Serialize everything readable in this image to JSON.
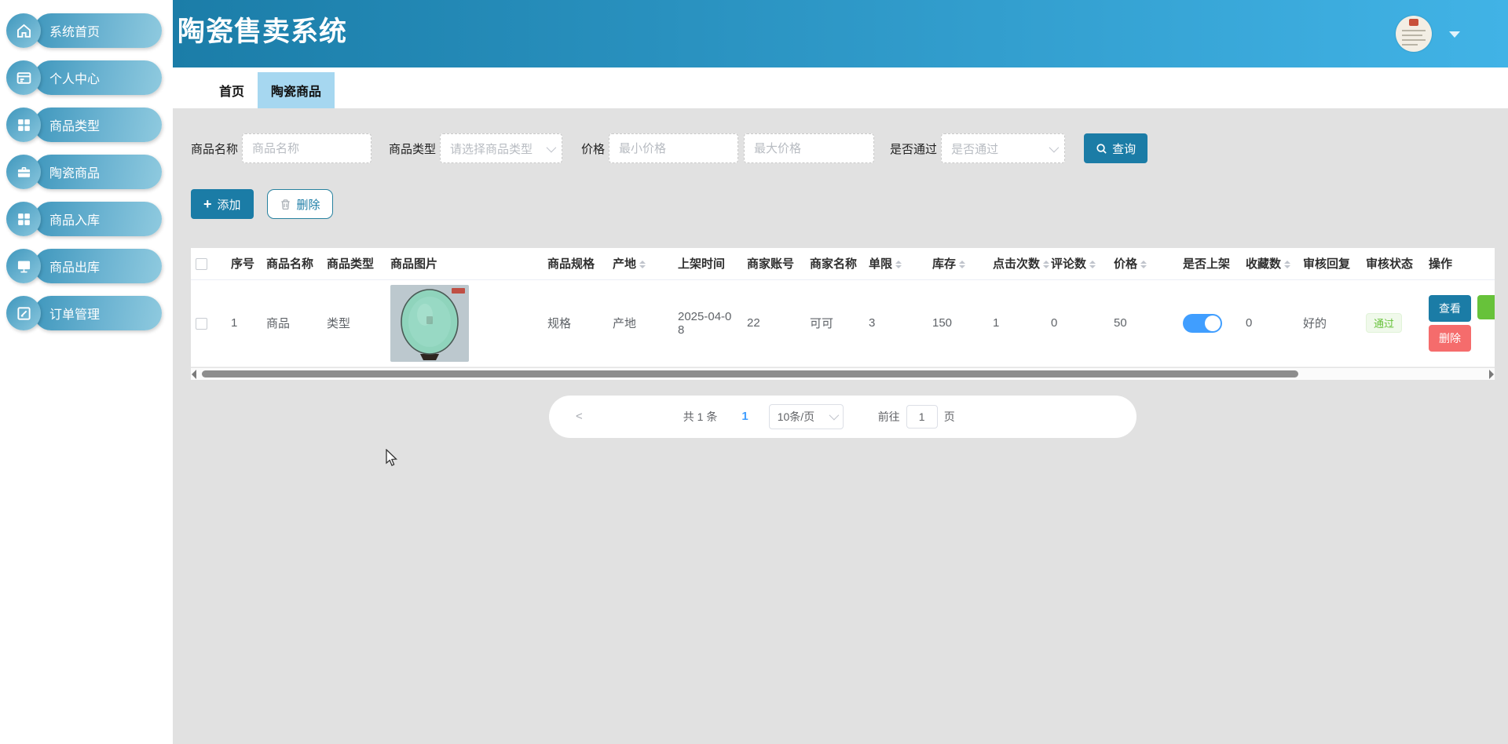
{
  "app": {
    "title": "陶瓷售卖系统"
  },
  "sidebar": {
    "items": [
      {
        "label": "系统首页",
        "icon": "home-icon"
      },
      {
        "label": "个人中心",
        "icon": "profile-card-icon"
      },
      {
        "label": "商品类型",
        "icon": "grid-icon"
      },
      {
        "label": "陶瓷商品",
        "icon": "briefcase-icon"
      },
      {
        "label": "商品入库",
        "icon": "grid-icon"
      },
      {
        "label": "商品出库",
        "icon": "monitor-icon"
      },
      {
        "label": "订单管理",
        "icon": "order-edit-icon"
      }
    ]
  },
  "header": {
    "avatar_icon": "user-avatar",
    "caret_icon": "chevron-down-icon"
  },
  "tabs": [
    {
      "label": "首页",
      "active": false
    },
    {
      "label": "陶瓷商品",
      "active": true
    }
  ],
  "filters": {
    "name_label": "商品名称",
    "name_placeholder": "商品名称",
    "type_label": "商品类型",
    "type_placeholder": "请选择商品类型",
    "price_label": "价格",
    "min_placeholder": "最小价格",
    "max_placeholder": "最大价格",
    "pass_label": "是否通过",
    "pass_placeholder": "是否通过",
    "search_label": "查询",
    "search_icon": "search-icon"
  },
  "toolbar": {
    "add_label": "添加",
    "delete_label": "删除",
    "delete_icon": "trash-icon"
  },
  "table": {
    "columns": [
      {
        "checkbox": true,
        "name": "select-all",
        "label": "",
        "sortable": false
      },
      {
        "name": "index",
        "label": "序号",
        "sortable": false
      },
      {
        "name": "product-name",
        "label": "商品名称",
        "sortable": false
      },
      {
        "name": "product-type",
        "label": "商品类型",
        "sortable": false
      },
      {
        "name": "product-image",
        "label": "商品图片",
        "sortable": false
      },
      {
        "name": "spec",
        "label": "商品规格",
        "sortable": false
      },
      {
        "name": "origin",
        "label": "产地",
        "sortable": true
      },
      {
        "name": "shelf-time",
        "label": "上架时间",
        "sortable": false
      },
      {
        "name": "merchant-account",
        "label": "商家账号",
        "sortable": false
      },
      {
        "name": "merchant-name",
        "label": "商家名称",
        "sortable": false
      },
      {
        "name": "limit",
        "label": "单限",
        "sortable": true
      },
      {
        "name": "stock",
        "label": "库存",
        "sortable": true
      },
      {
        "name": "clicks",
        "label": "点击次数",
        "sortable": true
      },
      {
        "name": "comments",
        "label": "评论数",
        "sortable": true
      },
      {
        "name": "price",
        "label": "价格",
        "sortable": true
      },
      {
        "name": "on-shelf",
        "label": "是否上架",
        "sortable": false
      },
      {
        "name": "favorites",
        "label": "收藏数",
        "sortable": true
      },
      {
        "name": "review-reply",
        "label": "审核回复",
        "sortable": false
      },
      {
        "name": "review-status",
        "label": "审核状态",
        "sortable": false
      },
      {
        "name": "actions",
        "label": "操作",
        "sortable": false
      }
    ],
    "row": {
      "index": "1",
      "name": "商品",
      "type": "类型",
      "image": "ceramic-plate-photo",
      "spec": "规格",
      "origin": "产地",
      "shelf_date": "2025-04-08",
      "merchant_account": "22",
      "merchant_name": "可可",
      "limit": "3",
      "stock": "150",
      "clicks": "1",
      "comments": "0",
      "price": "50",
      "on_shelf": true,
      "favorites": "0",
      "review_reply": "好的",
      "review_status": "通过",
      "view_label": "查看",
      "delete_label": "删除"
    }
  },
  "pagination": {
    "prev": "<",
    "total": "共 1 条",
    "current_page": "1",
    "page_size": "10条/页",
    "goto_prefix": "前往",
    "goto_value": "1",
    "goto_suffix": "页"
  },
  "colors": {
    "accent_teal": "#1b7ca6",
    "header_gradient_start": "#1b7da8",
    "header_gradient_end": "#41b3e6",
    "active_tab_bg": "#a6d7f0",
    "toggle_on": "#409eff",
    "tag_pass_green": "#67c23a",
    "delete_red": "#f56c6c",
    "page_current_blue": "#409eff"
  }
}
